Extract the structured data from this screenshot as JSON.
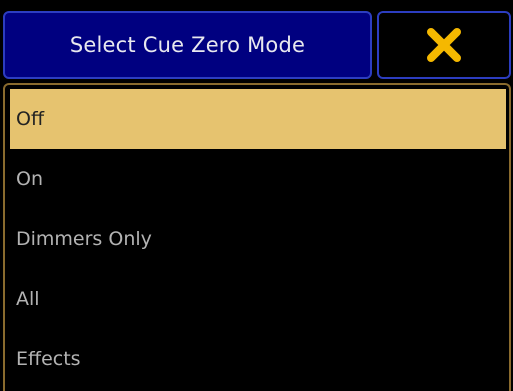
{
  "dialog": {
    "title": "Select Cue Zero Mode",
    "close_icon": "close-x-icon",
    "accent_colors": {
      "title_bg": "#000080",
      "close_x": "#f5b800",
      "selected_bg": "#e6c36f"
    }
  },
  "options": {
    "items": [
      {
        "label": "Off",
        "selected": true
      },
      {
        "label": "On",
        "selected": false
      },
      {
        "label": "Dimmers Only",
        "selected": false
      },
      {
        "label": "All",
        "selected": false
      },
      {
        "label": "Effects",
        "selected": false
      }
    ]
  }
}
